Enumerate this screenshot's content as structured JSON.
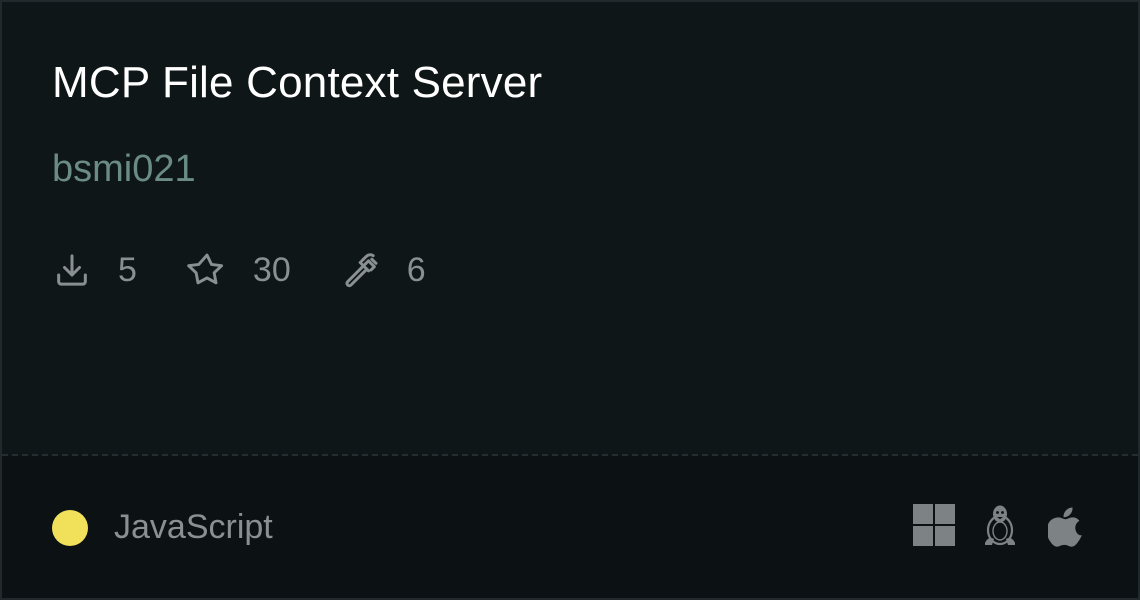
{
  "server": {
    "title": "MCP File Context Server",
    "author": "bsmi021"
  },
  "stats": [
    {
      "icon": "download-icon",
      "value": "5"
    },
    {
      "icon": "star-icon",
      "value": "30"
    },
    {
      "icon": "hammer-icon",
      "value": "6"
    }
  ],
  "language": {
    "name": "JavaScript",
    "color": "#f1e05a"
  },
  "platforms": [
    "windows-icon",
    "linux-icon",
    "apple-icon"
  ],
  "colors": {
    "background": "#0f1618",
    "footer_background": "#0c1113",
    "title": "#ffffff",
    "author": "#6a8c83",
    "muted": "#8a8f92"
  }
}
